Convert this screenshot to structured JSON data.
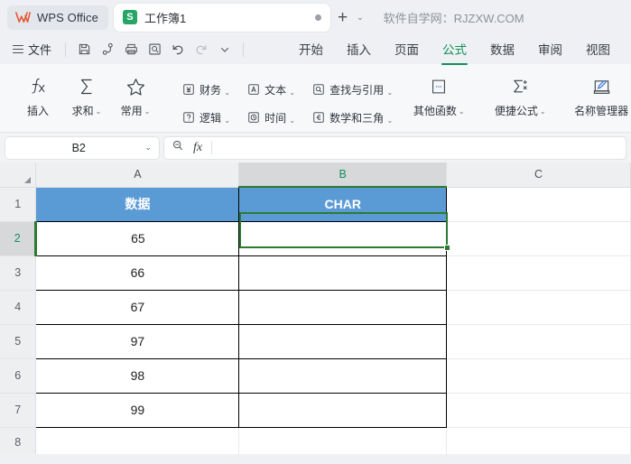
{
  "titlebar": {
    "brand": "WPS Office",
    "brand_logo_icon": "wps-logo-icon",
    "doc_tab": {
      "icon": "spreadsheet-s-icon",
      "title": "工作簿1",
      "modified_dot": "•"
    },
    "new_tab_label": "+",
    "new_tab_chevron": "⌄",
    "watermark": "软件自学网：RJZXW.COM"
  },
  "menubar": {
    "file_label": "文件",
    "quick_access": [
      {
        "name": "save-icon",
        "title": "保存"
      },
      {
        "name": "share-icon",
        "title": "分享"
      },
      {
        "name": "print-icon",
        "title": "打印"
      },
      {
        "name": "print-preview-icon",
        "title": "打印预览"
      },
      {
        "name": "undo-icon",
        "title": "撤销"
      },
      {
        "name": "redo-icon",
        "title": "恢复"
      },
      {
        "name": "chevron-down-icon",
        "title": "更多"
      }
    ],
    "tabs": [
      {
        "label": "开始",
        "active": false
      },
      {
        "label": "插入",
        "active": false
      },
      {
        "label": "页面",
        "active": false
      },
      {
        "label": "公式",
        "active": true
      },
      {
        "label": "数据",
        "active": false
      },
      {
        "label": "审阅",
        "active": false
      },
      {
        "label": "视图",
        "active": false
      }
    ]
  },
  "ribbon": {
    "insert_function": {
      "icon": "fx-icon",
      "label": "插入"
    },
    "autosum": {
      "icon": "sigma-icon",
      "label": "求和",
      "chevron": "⌄"
    },
    "common": {
      "icon": "star-icon",
      "label": "常用",
      "chevron": "⌄"
    },
    "categories": [
      {
        "icon": "currency-icon",
        "label": "财务",
        "chevron": "⌄"
      },
      {
        "icon": "text-a-icon",
        "label": "文本",
        "chevron": "⌄"
      },
      {
        "icon": "lookup-icon",
        "label": "查找与引用",
        "chevron": "⌄"
      },
      {
        "icon": "logic-icon",
        "label": "逻辑",
        "chevron": "⌄"
      },
      {
        "icon": "clock-icon",
        "label": "时间",
        "chevron": "⌄"
      },
      {
        "icon": "math-icon",
        "label": "数学和三角",
        "chevron": "⌄"
      }
    ],
    "other_functions": {
      "icon": "more-functions-icon",
      "label": "其他函数",
      "chevron": "⌄"
    },
    "quick_formula": {
      "icon": "sigma-plus-icon",
      "label": "便捷公式",
      "chevron": "⌄"
    },
    "name_manager": {
      "icon": "name-manager-icon",
      "label": "名称管理器"
    }
  },
  "formulabar": {
    "name_box_value": "B2",
    "name_box_chevron": "⌄",
    "zoom_icon": "magnifier-minus-icon",
    "fx_icon": "fx-icon",
    "formula_value": ""
  },
  "sheet": {
    "columns": [
      "A",
      "B",
      "C"
    ],
    "selected_column": "B",
    "selected_row": 2,
    "selected_cell": "B2",
    "rows": [
      {
        "num": "1",
        "a": "数据",
        "b": "CHAR",
        "header": true
      },
      {
        "num": "2",
        "a": "65",
        "b": ""
      },
      {
        "num": "3",
        "a": "66",
        "b": ""
      },
      {
        "num": "4",
        "a": "67",
        "b": ""
      },
      {
        "num": "5",
        "a": "97",
        "b": ""
      },
      {
        "num": "6",
        "a": "98",
        "b": ""
      },
      {
        "num": "7",
        "a": "99",
        "b": ""
      },
      {
        "num": "8",
        "a": "",
        "b": "",
        "empty": true
      }
    ]
  },
  "colors": {
    "table_header_blue": "#5b9bd5",
    "selection_green": "#2d7a32",
    "active_tab_green": "#12915a",
    "chrome_bg": "#eef0f3"
  }
}
